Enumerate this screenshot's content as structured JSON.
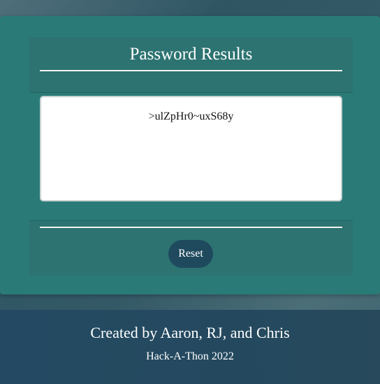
{
  "card": {
    "title": "Password Results",
    "result_text": ">ulZpHr0~uxS68y",
    "reset_label": "Reset"
  },
  "footer": {
    "credits": "Created by Aaron, RJ, and Chris",
    "event": "Hack-A-Thon 2022"
  },
  "colors": {
    "card": "#2a7b78",
    "button": "#1f4a5e",
    "footer": "#234a62"
  }
}
